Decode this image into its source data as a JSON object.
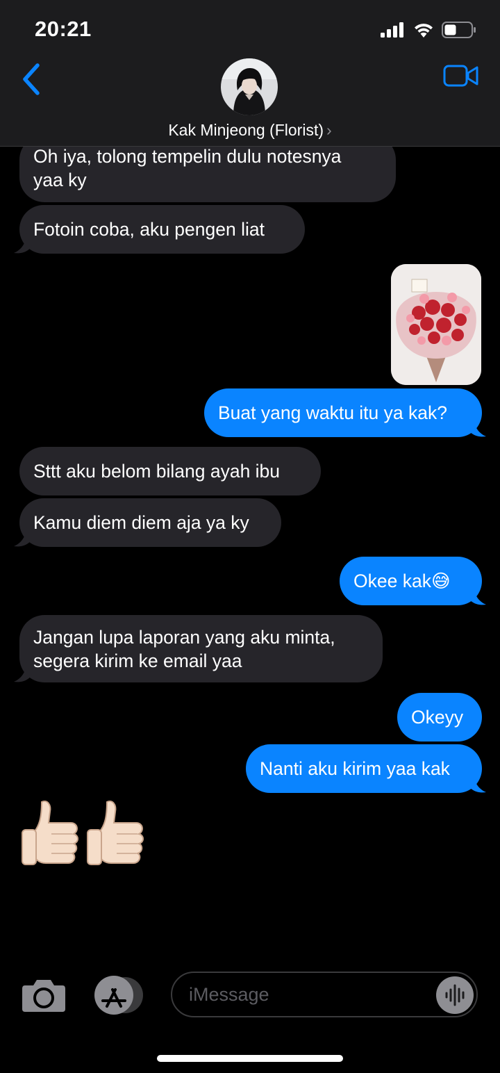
{
  "status_bar": {
    "time": "20:21"
  },
  "header": {
    "contact_name": "Kak Minjeong (Florist)"
  },
  "messages": [
    {
      "direction": "in",
      "text_lines": [
        "Oh iya, tolong tempelin dulu notesnya",
        "yaa ky"
      ]
    },
    {
      "direction": "in",
      "text": "Fotoin coba, aku pengen liat"
    },
    {
      "direction": "out",
      "type": "photo",
      "content": "flower-bouquet-photo"
    },
    {
      "direction": "out",
      "text": "Buat yang waktu itu ya kak?"
    },
    {
      "direction": "in",
      "text": "Sttt aku belom bilang ayah ibu"
    },
    {
      "direction": "in",
      "text": "Kamu diem diem aja ya ky"
    },
    {
      "direction": "out",
      "text": "Okee kak",
      "emoji": "😅"
    },
    {
      "direction": "in",
      "text_lines": [
        "Jangan lupa laporan yang aku minta,",
        "segera kirim ke email yaa"
      ]
    },
    {
      "direction": "out",
      "text": "Okeyy"
    },
    {
      "direction": "out",
      "text": "Nanti aku kirim yaa kak"
    },
    {
      "direction": "in",
      "type": "emoji",
      "text": "👍🏻👍🏻"
    }
  ],
  "composer": {
    "placeholder": "iMessage"
  },
  "colors": {
    "outgoing_bubble": "#0a84ff",
    "incoming_bubble": "#26252a",
    "accent": "#0a84ff"
  }
}
